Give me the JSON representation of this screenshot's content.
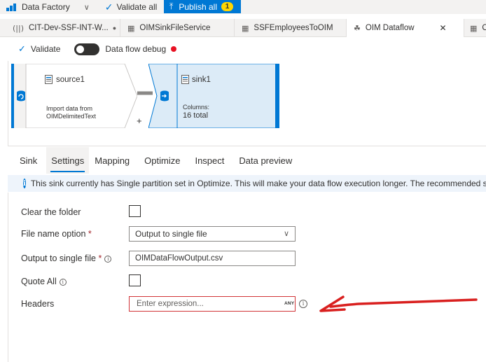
{
  "toolbar": {
    "app_name": "Data Factory",
    "validate_all": "Validate all",
    "publish_all": "Publish all",
    "publish_count": "1"
  },
  "tabs": [
    {
      "label": "CIT-Dev-SSF-INT-W...",
      "icon": "pipeline-icon",
      "modified": true
    },
    {
      "label": "OIMSinkFileService",
      "icon": "dataset-table-icon"
    },
    {
      "label": "SSFEmployeesToOIM",
      "icon": "dataset-table-icon"
    },
    {
      "label": "OIM Dataflow",
      "icon": "dataflow-icon",
      "active": true
    },
    {
      "label": "O",
      "icon": "dataset-table-icon"
    }
  ],
  "subbar": {
    "validate": "Validate",
    "debug_label": "Data flow debug",
    "debug_on": false
  },
  "canvas": {
    "source": {
      "name": "source1",
      "description_line1": "Import data from",
      "description_line2": "OIMDelimitedText"
    },
    "add_symbol": "+",
    "sink": {
      "name": "sink1",
      "columns_label": "Columns:",
      "columns_value": "16 total"
    }
  },
  "property_tabs": [
    "Sink",
    "Settings",
    "Mapping",
    "Optimize",
    "Inspect",
    "Data preview"
  ],
  "active_property_tab": "Settings",
  "banner": {
    "text": "This sink currently has Single partition set in Optimize. This will make your data flow execution longer. The recommended set"
  },
  "form": {
    "clear_folder": {
      "label": "Clear the folder",
      "checked": false
    },
    "file_name_option": {
      "label": "File name option",
      "required": "*",
      "value": "Output to single file"
    },
    "output_single_file": {
      "label": "Output to single file",
      "required": "*",
      "value": "OIMDataFlowOutput.csv"
    },
    "quote_all": {
      "label": "Quote All",
      "checked": false
    },
    "headers": {
      "label": "Headers",
      "placeholder": "Enter expression...",
      "type_tag": "ANY"
    }
  },
  "colors": {
    "accent": "#0078d4",
    "error_border": "#d13438",
    "badge": "#ffd700",
    "debug_dot": "#e81123",
    "annotation_arrow": "#d9201f"
  }
}
